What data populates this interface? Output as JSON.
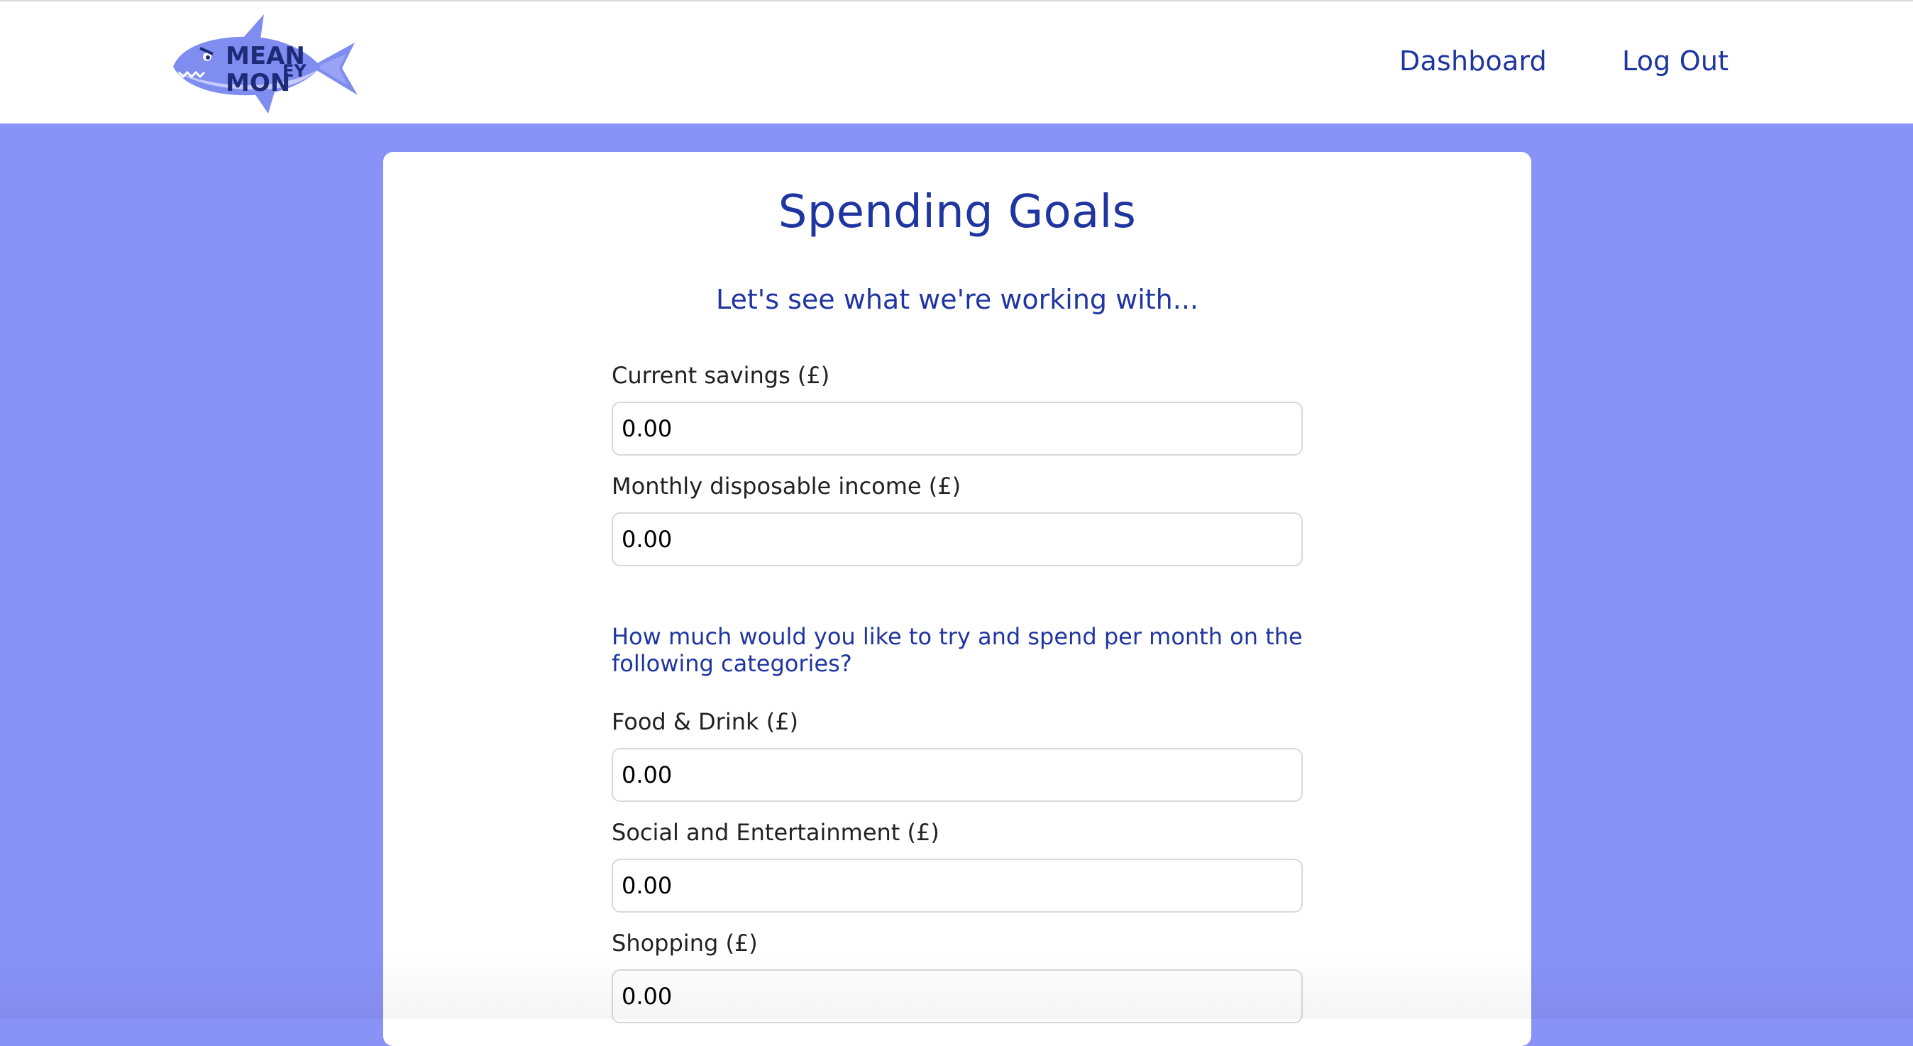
{
  "header": {
    "logo": {
      "text_line_1": "MEAN",
      "text_line_2": "MON",
      "text_line_3": "EY",
      "icon": "shark-logo-icon",
      "color": "#7f8cf0"
    },
    "nav": {
      "dashboard_label": "Dashboard",
      "logout_label": "Log Out"
    }
  },
  "main": {
    "title": "Spending Goals",
    "subtitle": "Let's see what we're working with...",
    "fields": {
      "current_savings": {
        "label": "Current savings (£)",
        "value": "0.00"
      },
      "monthly_income": {
        "label": "Monthly disposable income (£)",
        "value": "0.00"
      },
      "food_drink": {
        "label": "Food & Drink (£)",
        "value": "0.00"
      },
      "social_entertainment": {
        "label": "Social and Entertainment (£)",
        "value": "0.00"
      },
      "shopping": {
        "label": "Shopping (£)",
        "value": "0.00"
      }
    },
    "categories_question": "How much would you like to try and spend per month on the following categories?"
  },
  "colors": {
    "background": "#8992f7",
    "accent_text": "#1f35a0",
    "card": "#ffffff"
  }
}
